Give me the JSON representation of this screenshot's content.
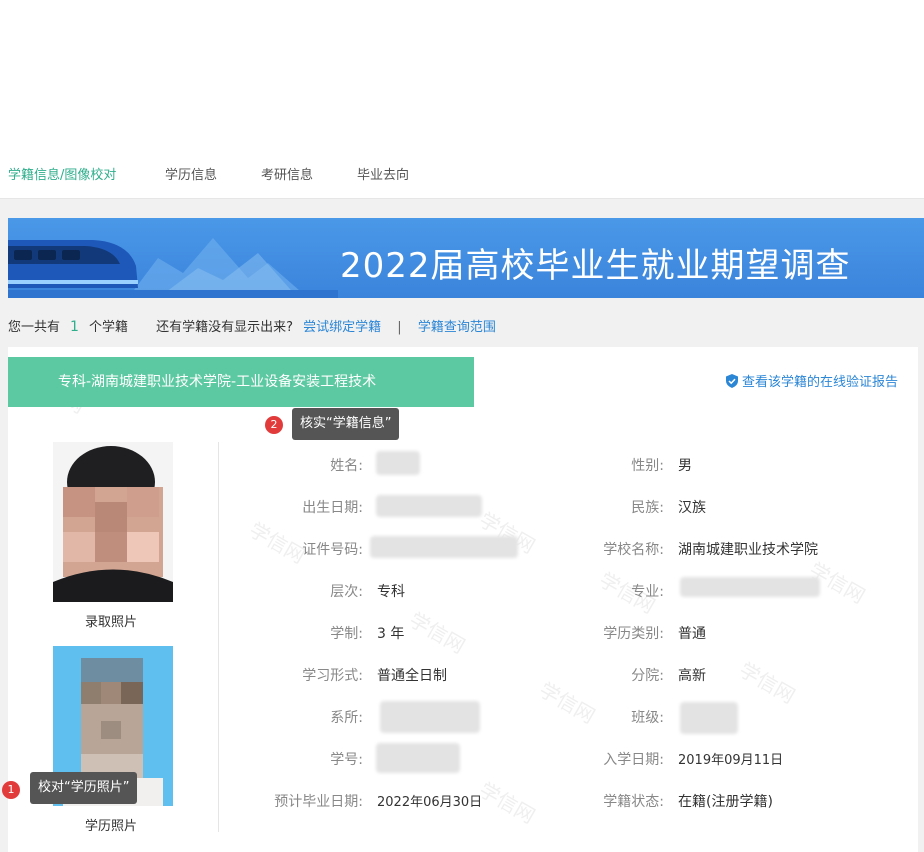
{
  "nav": {
    "tabs": [
      "学籍信息/图像校对",
      "学历信息",
      "考研信息",
      "毕业去向"
    ]
  },
  "banner": {
    "title": "2022届高校毕业生就业期望调查"
  },
  "summary": {
    "prefix": "您一共有",
    "count": "1",
    "suffix": "个学籍",
    "question": "还有学籍没有显示出来?",
    "bind_link": "尝试绑定学籍",
    "separator": "|",
    "scope_link": "学籍查询范围"
  },
  "record": {
    "school_tag": "专科-湖南城建职业技术学院-工业设备安装工程技术",
    "verify_link": "查看该学籍的在线验证报告",
    "tip_info": {
      "badge": "2",
      "text": "核实“学籍信息”"
    },
    "tip_photo": {
      "badge": "1",
      "text": "校对“学历照片”"
    },
    "photo_admission_caption": "录取照片",
    "photo_diploma_caption": "学历照片",
    "watermark": "学信网",
    "fields_left": [
      {
        "label": "姓名:",
        "value": ""
      },
      {
        "label": "出生日期:",
        "value": ""
      },
      {
        "label": "证件号码:",
        "value": ""
      },
      {
        "label": "层次:",
        "value": "专科"
      },
      {
        "label": "学制:",
        "value": "3 年"
      },
      {
        "label": "学习形式:",
        "value": "普通全日制"
      },
      {
        "label": "系所:",
        "value": ""
      },
      {
        "label": "学号:",
        "value": ""
      },
      {
        "label": "预计毕业日期:",
        "value": "2022年06月30日"
      }
    ],
    "fields_right": [
      {
        "label": "性别:",
        "value": "男"
      },
      {
        "label": "民族:",
        "value": "汉族"
      },
      {
        "label": "学校名称:",
        "value": "湖南城建职业技术学院"
      },
      {
        "label": "专业:",
        "value": ""
      },
      {
        "label": "学历类别:",
        "value": "普通"
      },
      {
        "label": "分院:",
        "value": "高新"
      },
      {
        "label": "班级:",
        "value": ""
      },
      {
        "label": "入学日期:",
        "value": "2019年09月11日"
      },
      {
        "label": "学籍状态:",
        "value": "在籍(注册学籍)"
      }
    ]
  },
  "colors": {
    "accent_green": "#2fae8c",
    "tag_green": "#5dc9a2",
    "link_blue": "#2b86d6",
    "banner_blue": "#3b84dc",
    "badge_red": "#e23b3b"
  }
}
